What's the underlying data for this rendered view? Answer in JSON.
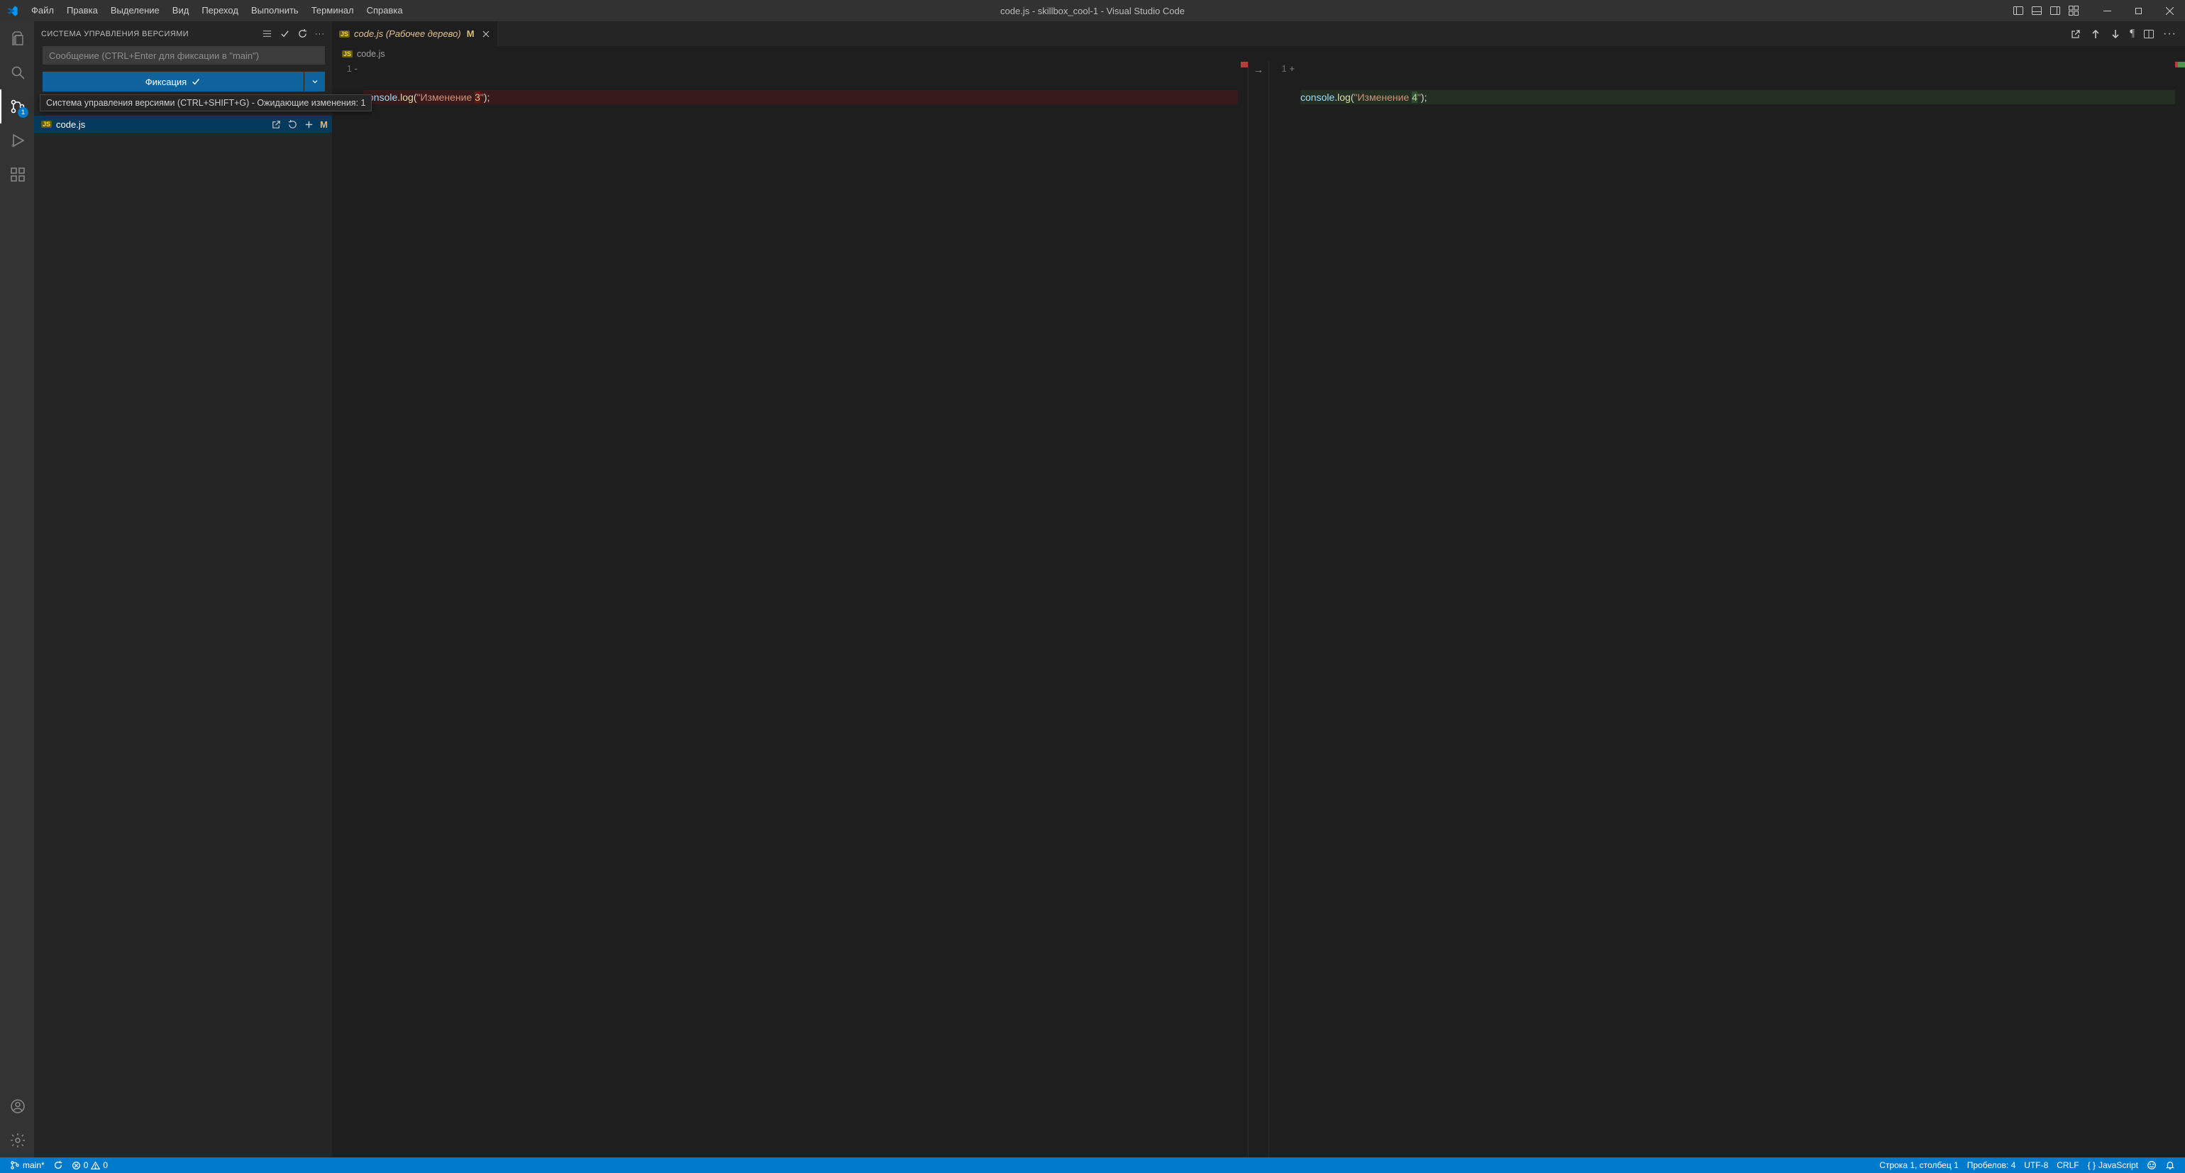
{
  "titlebar": {
    "menus": [
      "Файл",
      "Правка",
      "Выделение",
      "Вид",
      "Переход",
      "Выполнить",
      "Терминал",
      "Справка"
    ],
    "title": "code.js - skillbox_cool-1 - Visual Studio Code"
  },
  "activity": {
    "scm_badge": "1"
  },
  "scm": {
    "panel_title": "СИСТЕМА УПРАВЛЕНИЯ ВЕРСИЯМИ",
    "commit_placeholder": "Сообщение (CTRL+Enter для фиксации в \"main\")",
    "commit_btn": "Фиксация",
    "tooltip": "Система управления версиями (CTRL+SHIFT+G) - Ожидающие изменения: 1",
    "file": {
      "name": "code.js",
      "status": "M"
    }
  },
  "tab": {
    "label": "code.js (Рабочее дерево)",
    "status": "M"
  },
  "breadcrumb": {
    "file": "code.js"
  },
  "diff": {
    "left": {
      "lineno": "1",
      "sign": "-",
      "pre": "console",
      "method": "log",
      "str_a": "\"Изменение ",
      "num": "3",
      "str_b": "\""
    },
    "right": {
      "lineno": "1",
      "sign": "+",
      "pre": "console",
      "method": "log",
      "str_a": "\"Изменение ",
      "num": "4",
      "str_b": "\""
    }
  },
  "statusbar": {
    "branch": "main*",
    "errors": "0",
    "warnings": "0",
    "cursor": "Строка 1, столбец 1",
    "spaces": "Пробелов: 4",
    "encoding": "UTF-8",
    "eol": "CRLF",
    "lang": "JavaScript"
  }
}
